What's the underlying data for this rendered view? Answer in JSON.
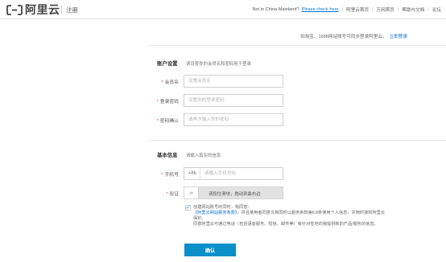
{
  "header": {
    "logo_text": "阿里云",
    "page_tag": "注册",
    "region_prompt": "Not in China Mainland?",
    "region_link": "Please check here",
    "nav": [
      "阿里云首页",
      "万网首页",
      "帮助与文档",
      "论坛"
    ]
  },
  "account_tip": {
    "text": "如淘宝、1688网站账号可同步登录阿里云，",
    "link": "立即登录"
  },
  "account_section": {
    "title": "账户设置",
    "desc": "请设置你的会员名和密码用于登录",
    "fields": [
      {
        "label": "会员名",
        "placeholder": "设置会员名",
        "required": true
      },
      {
        "label": "登录密码",
        "placeholder": "设置你的登录密码",
        "required": true
      },
      {
        "label": "密码确认",
        "placeholder": "请再次输入你的密码",
        "required": true
      }
    ]
  },
  "basic_section": {
    "title": "基本信息",
    "desc": "请输入真实的信息",
    "phone": {
      "label": "手机号",
      "prefix": "+86",
      "placeholder": "请输入手机号码"
    },
    "verify": {
      "label": "验证",
      "handle": "≫",
      "text": "请按住滑块，拖动到最右边"
    }
  },
  "agreement": {
    "line1": "创建网站账号的同时，我同意：",
    "link": "《阿里云网站服务条款》",
    "line2": "，并且使用者同意文档同时以服务条款第6.8条使用个人信息，并随时授权阿里云保护。",
    "line3": "同意阿里云可通过电话（包括语音服务、短信、邮件等）有针对性地向我提供新的产品/服务的信息。"
  },
  "submit_label": "确认",
  "colors": {
    "brand": "#0a8fc9",
    "link": "#0a6ed1",
    "required": "#e4393c"
  }
}
